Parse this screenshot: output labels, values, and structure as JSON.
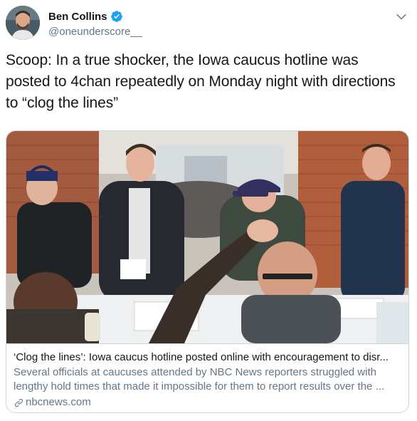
{
  "author": {
    "name": "Ben Collins",
    "handle": "@oneunderscore__",
    "verified": true
  },
  "tweet": {
    "text": "Scoop: In a true shocker, the Iowa caucus hotline was posted to 4chan repeatedly on Monday night with directions to “clog the lines”"
  },
  "card": {
    "title": "‘Clog the lines’: Iowa caucus hotline posted online with encouragement to disr...",
    "description_line1": "Several officials at caucuses attended by NBC News reporters struggled with",
    "description_line2": "lengthy hold times that made it impossible for them to report results over the ...",
    "domain": "nbcnews.com"
  },
  "icons": {
    "verified": "verified-badge-icon",
    "menu": "chevron-down-icon",
    "link": "link-icon"
  },
  "colors": {
    "primary_text": "#14171a",
    "secondary_text": "#657786",
    "verified_blue": "#1da1f2",
    "border": "#ccd6dd"
  }
}
